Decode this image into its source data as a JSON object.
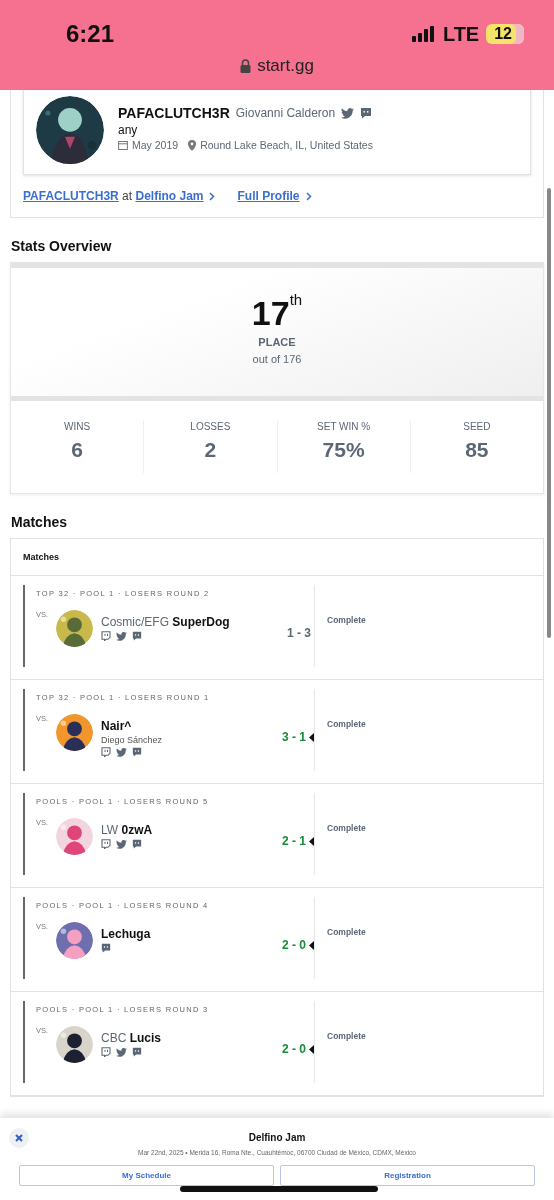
{
  "status_bar": {
    "time": "6:21",
    "network": "LTE",
    "battery": "12",
    "url": "start.gg"
  },
  "profile": {
    "tag": "PAFACLUTCH3R",
    "name": "Giovanni Calderon",
    "pronouns": "any",
    "joined": "May 2019",
    "location": "Round Lake Beach, IL, United States"
  },
  "links": [
    {
      "parts": [
        "PAFACLUTCH3R",
        " at ",
        "Delfino Jam"
      ]
    },
    {
      "parts": [
        "Full Profile"
      ]
    }
  ],
  "stats_overview": {
    "title": "Stats Overview",
    "placement": "17",
    "suffix": "th",
    "place_label": "PLACE",
    "out_of": "out of 176",
    "stats": [
      {
        "label": "WINS",
        "value": "6"
      },
      {
        "label": "LOSSES",
        "value": "2"
      },
      {
        "label": "SET WIN %",
        "value": "75%"
      },
      {
        "label": "SEED",
        "value": "85"
      }
    ]
  },
  "matches": {
    "title": "Matches",
    "table_title": "Matches",
    "rows": [
      {
        "round": "TOP 32 · POOL 1 · LOSERS ROUND 2",
        "vs": "VS.",
        "prefix": "Cosmic/EFG",
        "tag": "SuperDog",
        "score": "1 - 3",
        "won": false,
        "status": "Complete",
        "socials": [
          {
            "kind": "twitch"
          },
          {
            "kind": "twitter"
          },
          {
            "kind": "discord"
          }
        ]
      },
      {
        "round": "TOP 32 · POOL 1 · LOSERS ROUND 1",
        "vs": "VS.",
        "tag": "Nair^",
        "real_name": "Diego Sánchez",
        "score": "3 - 1",
        "won": true,
        "status": "Complete",
        "socials": [
          {
            "kind": "twitch"
          },
          {
            "kind": "twitter"
          },
          {
            "kind": "discord"
          }
        ]
      },
      {
        "round": "POOLS · POOL 1 · LOSERS ROUND 5",
        "vs": "VS.",
        "prefix": "LW",
        "tag": "0zwA",
        "score": "2 - 1",
        "won": true,
        "status": "Complete",
        "socials": [
          {
            "kind": "twitch"
          },
          {
            "kind": "twitter"
          },
          {
            "kind": "discord"
          }
        ]
      },
      {
        "round": "POOLS · POOL 1 · LOSERS ROUND 4",
        "vs": "VS.",
        "tag": "Lechuga",
        "score": "2 - 0",
        "won": true,
        "status": "Complete",
        "socials": [
          {
            "kind": "discord"
          }
        ]
      },
      {
        "round": "POOLS · POOL 1 · LOSERS ROUND 3",
        "vs": "VS.",
        "prefix": "CBC",
        "tag": "Lucis",
        "score": "2 - 0",
        "won": true,
        "status": "Complete",
        "socials": [
          {
            "kind": "twitch"
          },
          {
            "kind": "twitter"
          },
          {
            "kind": "discord"
          }
        ]
      }
    ]
  },
  "event_banner": {
    "title": "Delfino Jam",
    "details": "Mar 22nd, 2025 • Merida 16, Roma Nte., Cuauhtémoc, 06700 Ciudad de México, CDMX, México",
    "buttons": [
      "My Schedule",
      "Registration"
    ]
  }
}
